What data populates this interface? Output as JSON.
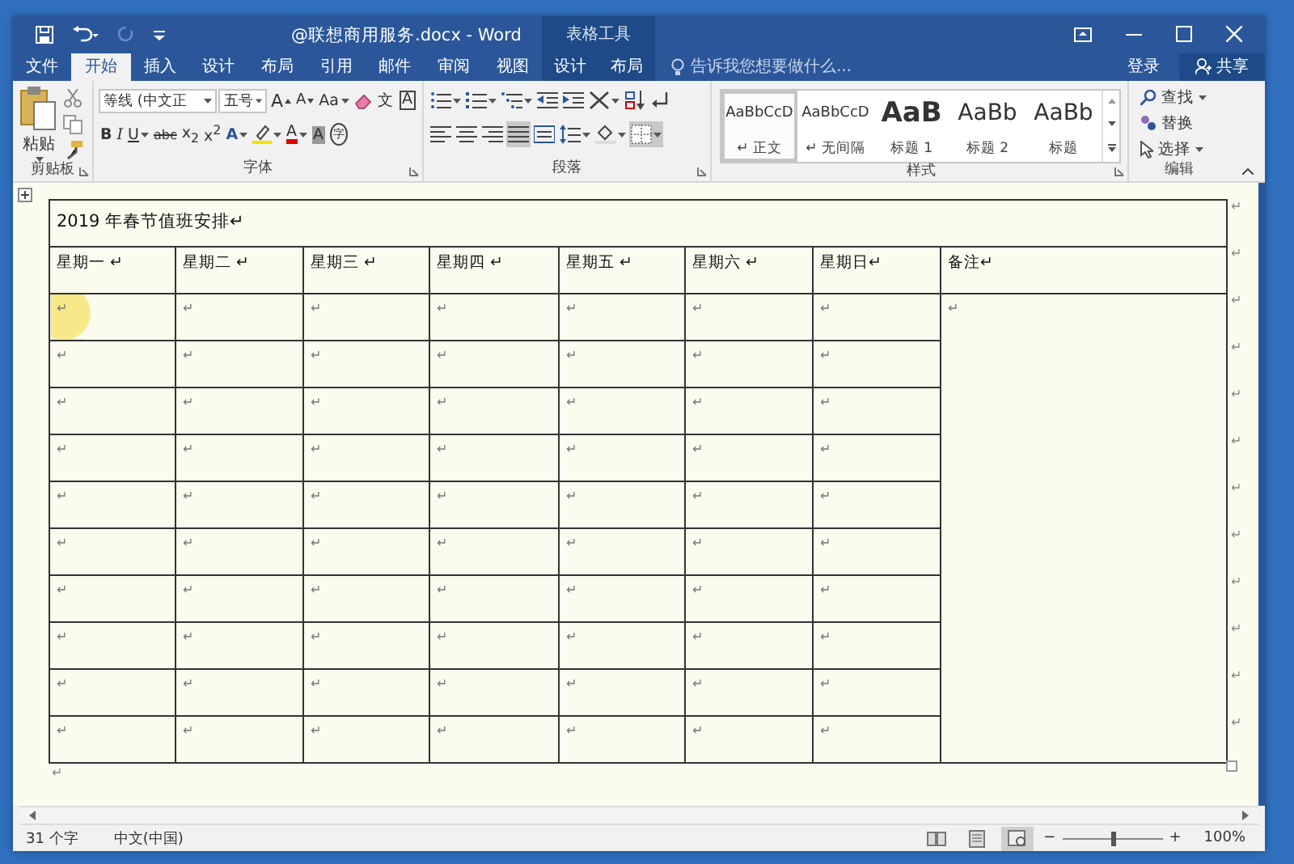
{
  "window": {
    "title": "@联想商用服务.docx - Word",
    "context_group": "表格工具"
  },
  "tabs": [
    {
      "label": "文件",
      "selected": false,
      "kind": "main"
    },
    {
      "label": "开始",
      "selected": true,
      "kind": "main"
    },
    {
      "label": "插入",
      "selected": false,
      "kind": "main"
    },
    {
      "label": "设计",
      "selected": false,
      "kind": "main"
    },
    {
      "label": "布局",
      "selected": false,
      "kind": "main"
    },
    {
      "label": "引用",
      "selected": false,
      "kind": "main"
    },
    {
      "label": "邮件",
      "selected": false,
      "kind": "main"
    },
    {
      "label": "审阅",
      "selected": false,
      "kind": "main"
    },
    {
      "label": "视图",
      "selected": false,
      "kind": "main"
    },
    {
      "label": "设计",
      "selected": false,
      "kind": "context"
    },
    {
      "label": "布局",
      "selected": false,
      "kind": "context"
    }
  ],
  "tell_me": {
    "placeholder": "告诉我您想要做什么..."
  },
  "sign_in": "登录",
  "share": "共享",
  "ribbon": {
    "clipboard": {
      "paste": "粘贴",
      "label": "剪贴板"
    },
    "font": {
      "font_name": "等线 (中文正",
      "font_size": "五号",
      "label": "字体",
      "row1": [
        {
          "kind": "grow",
          "label": "A",
          "dropdown": false
        },
        {
          "kind": "shrink",
          "label": "A",
          "dropdown": false
        },
        {
          "kind": "case",
          "label": "Aa",
          "dropdown": true
        },
        {
          "kind": "clear",
          "dropdown": false
        },
        {
          "kind": "phonetic",
          "label": "文",
          "dropdown": false
        },
        {
          "kind": "char-border",
          "label": "A",
          "dropdown": false
        }
      ],
      "row2": [
        {
          "kind": "bold",
          "label": "B",
          "dropdown": false
        },
        {
          "kind": "italic",
          "label": "I",
          "dropdown": false
        },
        {
          "kind": "underline",
          "label": "U",
          "dropdown": true
        },
        {
          "kind": "strike",
          "label": "abc",
          "dropdown": false
        },
        {
          "kind": "sub",
          "label": "x$_{2}$",
          "dropdown": false
        },
        {
          "kind": "sup",
          "label": "x$^{2}$",
          "dropdown": false
        },
        {
          "kind": "effects",
          "label": "A",
          "dropdown": true
        },
        {
          "kind": "highlight",
          "dropdown": true
        },
        {
          "kind": "font-color",
          "label": "A",
          "dropdown": true
        },
        {
          "kind": "shading",
          "label": "A",
          "dropdown": false
        },
        {
          "kind": "enclose",
          "label": "字",
          "dropdown": false
        }
      ]
    },
    "paragraph": {
      "label": "段落",
      "row1": [
        {
          "kind": "bullets",
          "dropdown": true,
          "pressed": false
        },
        {
          "kind": "numbering",
          "dropdown": true,
          "pressed": false
        },
        {
          "kind": "multilevel",
          "dropdown": true,
          "pressed": false
        },
        {
          "kind": "decrease-indent",
          "dropdown": false,
          "pressed": false
        },
        {
          "kind": "increase-indent",
          "dropdown": false,
          "pressed": false
        },
        {
          "kind": "asian-layout",
          "dropdown": true,
          "pressed": false
        },
        {
          "kind": "sort",
          "dropdown": false,
          "pressed": false
        },
        {
          "kind": "show-marks",
          "dropdown": false,
          "pressed": false
        }
      ],
      "row2": [
        {
          "kind": "align-left",
          "dropdown": false,
          "pressed": false
        },
        {
          "kind": "align-center",
          "dropdown": false,
          "pressed": false
        },
        {
          "kind": "align-right",
          "dropdown": false,
          "pressed": false
        },
        {
          "kind": "justify",
          "dropdown": false,
          "pressed": true
        },
        {
          "kind": "distributed",
          "dropdown": false,
          "pressed": false
        },
        {
          "kind": "line-spacing",
          "dropdown": true,
          "pressed": false
        },
        {
          "kind": "shading",
          "dropdown": true,
          "pressed": false
        },
        {
          "kind": "borders",
          "dropdown": true,
          "pressed": true
        }
      ]
    },
    "styles": {
      "label": "样式",
      "items": [
        {
          "preview": "AaBbCcD",
          "name": "↵ 正文",
          "kind": "normal",
          "selected": true
        },
        {
          "preview": "AaBbCcD",
          "name": "↵ 无间隔",
          "kind": "normal",
          "selected": false
        },
        {
          "preview": "AaB",
          "name": "标题 1",
          "kind": "heading1",
          "selected": false
        },
        {
          "preview": "AaBb",
          "name": "标题 2",
          "kind": "heading2",
          "selected": false
        },
        {
          "preview": "AaBb",
          "name": "标题",
          "kind": "heading2",
          "selected": false
        }
      ]
    },
    "editing": {
      "find": "查找",
      "replace": "替换",
      "select": "选择",
      "label": "编辑"
    }
  },
  "document": {
    "title_cell": "2019 年春节值班安排↵",
    "headers": [
      "星期一 ↵",
      "星期二 ↵",
      "星期三 ↵",
      "星期四 ↵",
      "星期五 ↵",
      "星期六 ↵",
      "星期日↵",
      "备注↵"
    ],
    "notes_cell": "↵",
    "rows": [
      {
        "cells": [
          {
            "text": "↵",
            "highlighted": true
          },
          {
            "text": "↵",
            "highlighted": false
          },
          {
            "text": "↵",
            "highlighted": false
          },
          {
            "text": "↵",
            "highlighted": false
          },
          {
            "text": "↵",
            "highlighted": false
          },
          {
            "text": "↵",
            "highlighted": false
          },
          {
            "text": "↵",
            "highlighted": false
          }
        ]
      },
      {
        "cells": [
          {
            "text": "↵",
            "highlighted": false
          },
          {
            "text": "↵",
            "highlighted": false
          },
          {
            "text": "↵",
            "highlighted": false
          },
          {
            "text": "↵",
            "highlighted": false
          },
          {
            "text": "↵",
            "highlighted": false
          },
          {
            "text": "↵",
            "highlighted": false
          },
          {
            "text": "↵",
            "highlighted": false
          }
        ]
      },
      {
        "cells": [
          {
            "text": "↵",
            "highlighted": false
          },
          {
            "text": "↵",
            "highlighted": false
          },
          {
            "text": "↵",
            "highlighted": false
          },
          {
            "text": "↵",
            "highlighted": false
          },
          {
            "text": "↵",
            "highlighted": false
          },
          {
            "text": "↵",
            "highlighted": false
          },
          {
            "text": "↵",
            "highlighted": false
          }
        ]
      },
      {
        "cells": [
          {
            "text": "↵",
            "highlighted": false
          },
          {
            "text": "↵",
            "highlighted": false
          },
          {
            "text": "↵",
            "highlighted": false
          },
          {
            "text": "↵",
            "highlighted": false
          },
          {
            "text": "↵",
            "highlighted": false
          },
          {
            "text": "↵",
            "highlighted": false
          },
          {
            "text": "↵",
            "highlighted": false
          }
        ]
      },
      {
        "cells": [
          {
            "text": "↵",
            "highlighted": false
          },
          {
            "text": "↵",
            "highlighted": false
          },
          {
            "text": "↵",
            "highlighted": false
          },
          {
            "text": "↵",
            "highlighted": false
          },
          {
            "text": "↵",
            "highlighted": false
          },
          {
            "text": "↵",
            "highlighted": false
          },
          {
            "text": "↵",
            "highlighted": false
          }
        ]
      },
      {
        "cells": [
          {
            "text": "↵",
            "highlighted": false
          },
          {
            "text": "↵",
            "highlighted": false
          },
          {
            "text": "↵",
            "highlighted": false
          },
          {
            "text": "↵",
            "highlighted": false
          },
          {
            "text": "↵",
            "highlighted": false
          },
          {
            "text": "↵",
            "highlighted": false
          },
          {
            "text": "↵",
            "highlighted": false
          }
        ]
      },
      {
        "cells": [
          {
            "text": "↵",
            "highlighted": false
          },
          {
            "text": "↵",
            "highlighted": false
          },
          {
            "text": "↵",
            "highlighted": false
          },
          {
            "text": "↵",
            "highlighted": false
          },
          {
            "text": "↵",
            "highlighted": false
          },
          {
            "text": "↵",
            "highlighted": false
          },
          {
            "text": "↵",
            "highlighted": false
          }
        ]
      },
      {
        "cells": [
          {
            "text": "↵",
            "highlighted": false
          },
          {
            "text": "↵",
            "highlighted": false
          },
          {
            "text": "↵",
            "highlighted": false
          },
          {
            "text": "↵",
            "highlighted": false
          },
          {
            "text": "↵",
            "highlighted": false
          },
          {
            "text": "↵",
            "highlighted": false
          },
          {
            "text": "↵",
            "highlighted": false
          }
        ]
      },
      {
        "cells": [
          {
            "text": "↵",
            "highlighted": false
          },
          {
            "text": "↵",
            "highlighted": false
          },
          {
            "text": "↵",
            "highlighted": false
          },
          {
            "text": "↵",
            "highlighted": false
          },
          {
            "text": "↵",
            "highlighted": false
          },
          {
            "text": "↵",
            "highlighted": false
          },
          {
            "text": "↵",
            "highlighted": false
          }
        ]
      },
      {
        "cells": [
          {
            "text": "↵",
            "highlighted": false
          },
          {
            "text": "↵",
            "highlighted": false
          },
          {
            "text": "↵",
            "highlighted": false
          },
          {
            "text": "↵",
            "highlighted": false
          },
          {
            "text": "↵",
            "highlighted": false
          },
          {
            "text": "↵",
            "highlighted": false
          },
          {
            "text": "↵",
            "highlighted": false
          }
        ]
      }
    ],
    "row_marks": [
      "↵",
      "↵",
      "↵",
      "↵",
      "↵",
      "↵",
      "↵",
      "↵",
      "↵",
      "↵",
      "↵",
      "↵"
    ],
    "after_table": "↵"
  },
  "status_bar": {
    "word_count": "31 个字",
    "language": "中文(中国)",
    "views": [
      {
        "kind": "read",
        "selected": false
      },
      {
        "kind": "print",
        "selected": false
      },
      {
        "kind": "web",
        "selected": true
      }
    ],
    "zoom_out": "−",
    "zoom_in": "+",
    "zoom": {
      "level": 0.5
    },
    "zoom_percent": "100%"
  }
}
